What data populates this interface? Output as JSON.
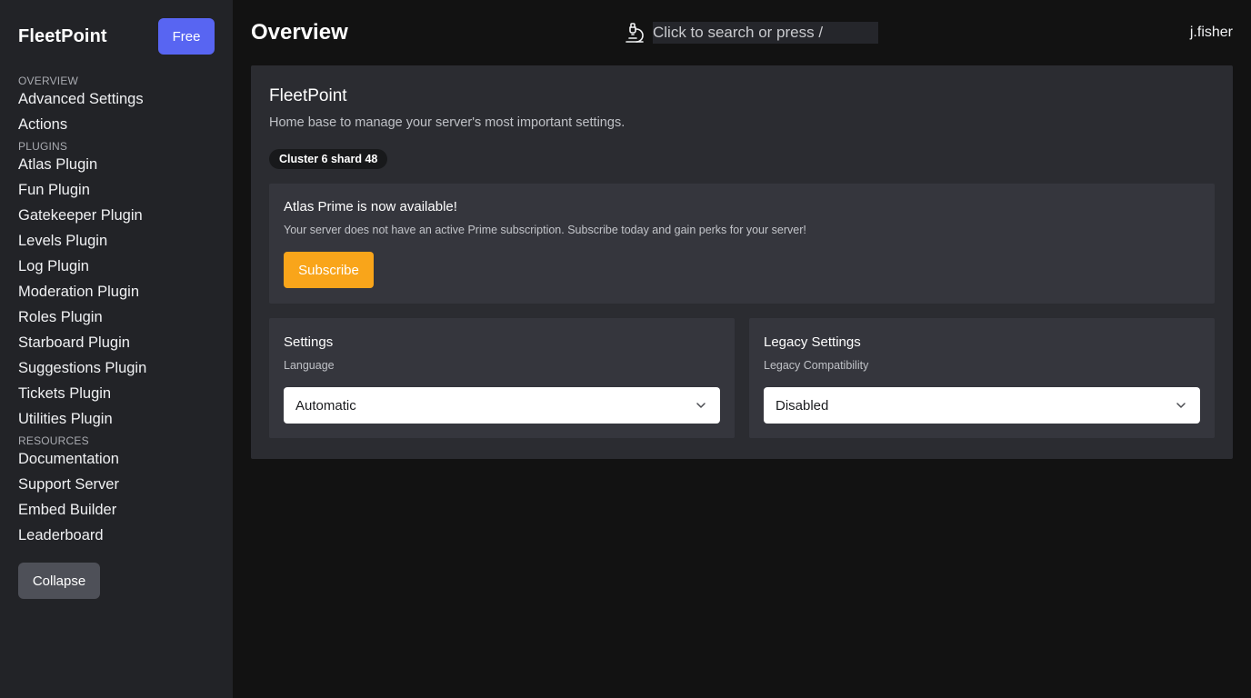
{
  "sidebar": {
    "brand": "FleetPoint",
    "plan_label": "Free",
    "sections": [
      {
        "title": "OVERVIEW",
        "items": [
          "Advanced Settings",
          "Actions"
        ]
      },
      {
        "title": "PLUGINS",
        "items": [
          "Atlas Plugin",
          "Fun Plugin",
          "Gatekeeper Plugin",
          "Levels Plugin",
          "Log Plugin",
          "Moderation Plugin",
          "Roles Plugin",
          "Starboard Plugin",
          "Suggestions Plugin",
          "Tickets Plugin",
          "Utilities Plugin"
        ]
      },
      {
        "title": "RESOURCES",
        "items": [
          "Documentation",
          "Support Server",
          "Embed Builder",
          "Leaderboard"
        ]
      }
    ],
    "collapse_label": "Collapse"
  },
  "header": {
    "title": "Overview",
    "search_placeholder": "Click to search or press /",
    "search_icon": "microscope-icon",
    "username": "j.fisher"
  },
  "main": {
    "title": "FleetPoint",
    "subtitle": "Home base to manage your server's most important settings.",
    "badge": "Cluster 6 shard 48",
    "prime": {
      "title": "Atlas Prime is now available!",
      "text": "Your server does not have an active Prime subscription. Subscribe today and gain perks for your server!",
      "button": "Subscribe"
    },
    "settings": {
      "title": "Settings",
      "field_label": "Language",
      "value": "Automatic"
    },
    "legacy": {
      "title": "Legacy Settings",
      "field_label": "Legacy Compatibility",
      "value": "Disabled"
    }
  },
  "colors": {
    "accent": "#5865f2",
    "subscribe": "#f9a51a",
    "background": "#121212",
    "sidebar": "#222327",
    "card": "#2b2c31",
    "panel": "#35363d"
  }
}
